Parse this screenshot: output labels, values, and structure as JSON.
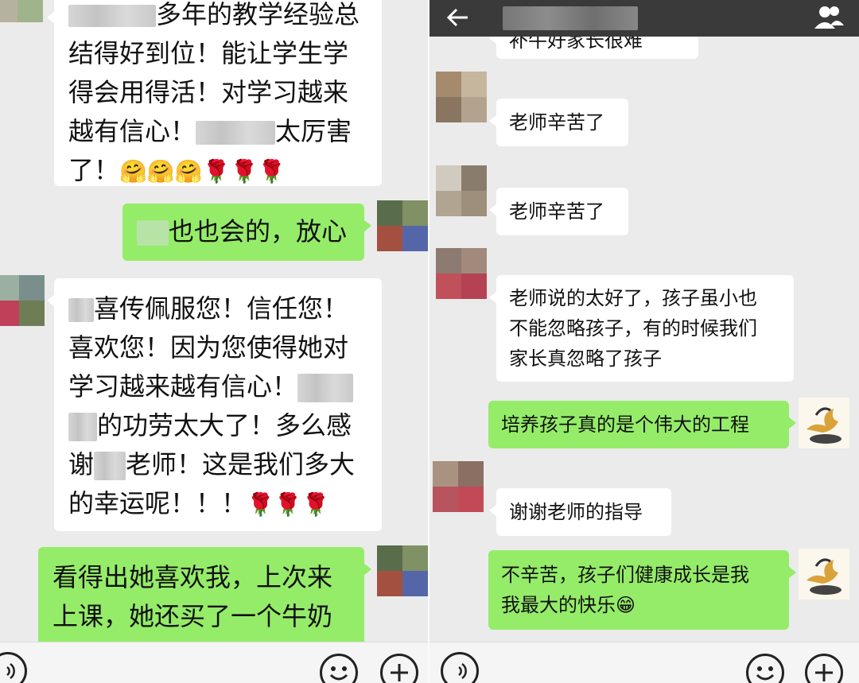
{
  "left": {
    "msg1": {
      "line1_prefix": "",
      "line1_text": "多年的教学经验总",
      "line2": "结得好到位！能让学生学",
      "line3": "得会用得活！对学习越来",
      "line4_a": "越有信心！",
      "line4_b": "太厉害",
      "line5": "了！",
      "emoji": "🤗🤗🤗🌹🌹🌹"
    },
    "msg2": {
      "text": "也也会的，放心"
    },
    "msg3": {
      "line1": "喜传佩服您！信任您！",
      "line2": "喜欢您！因为您使得她对",
      "line3": "学习越来越有信心！",
      "line4": "的功劳太大了！多么感",
      "line5_a": "谢",
      "line5_b": "老师！这是我们多大",
      "line6": "的幸运呢！！！",
      "emoji": "🌹🌹🌹"
    },
    "msg4": {
      "line1": "看得出她喜欢我，上次来",
      "line2": "上课，她还买了一个牛奶"
    }
  },
  "right": {
    "msg0": {
      "text": "补牛好家长很难"
    },
    "msg1": {
      "text": "老师辛苦了"
    },
    "msg2": {
      "text": "老师辛苦了"
    },
    "msg3": {
      "line1": "老师说的太好了，孩子虽小也",
      "line2": "不能忽略孩子，有的时候我们",
      "line3": "家长真忽略了孩子"
    },
    "msg4": {
      "text": "培养孩子真的是个伟大的工程"
    },
    "msg5": {
      "text": "谢谢老师的指导"
    },
    "msg6": {
      "line1": "不辛苦，孩子们健康成长是我",
      "line2": "我最大的快乐",
      "emoji": "😁"
    }
  },
  "colors": {
    "background": "#ebebeb",
    "sent_bubble": "#95ec69",
    "received_bubble": "#ffffff",
    "topbar": "#3a3a3a"
  },
  "icons": {
    "back": "back-arrow-icon",
    "contact": "contact-info-icon",
    "voice": "voice-input-icon",
    "emoji": "emoji-icon",
    "plus": "plus-icon"
  }
}
